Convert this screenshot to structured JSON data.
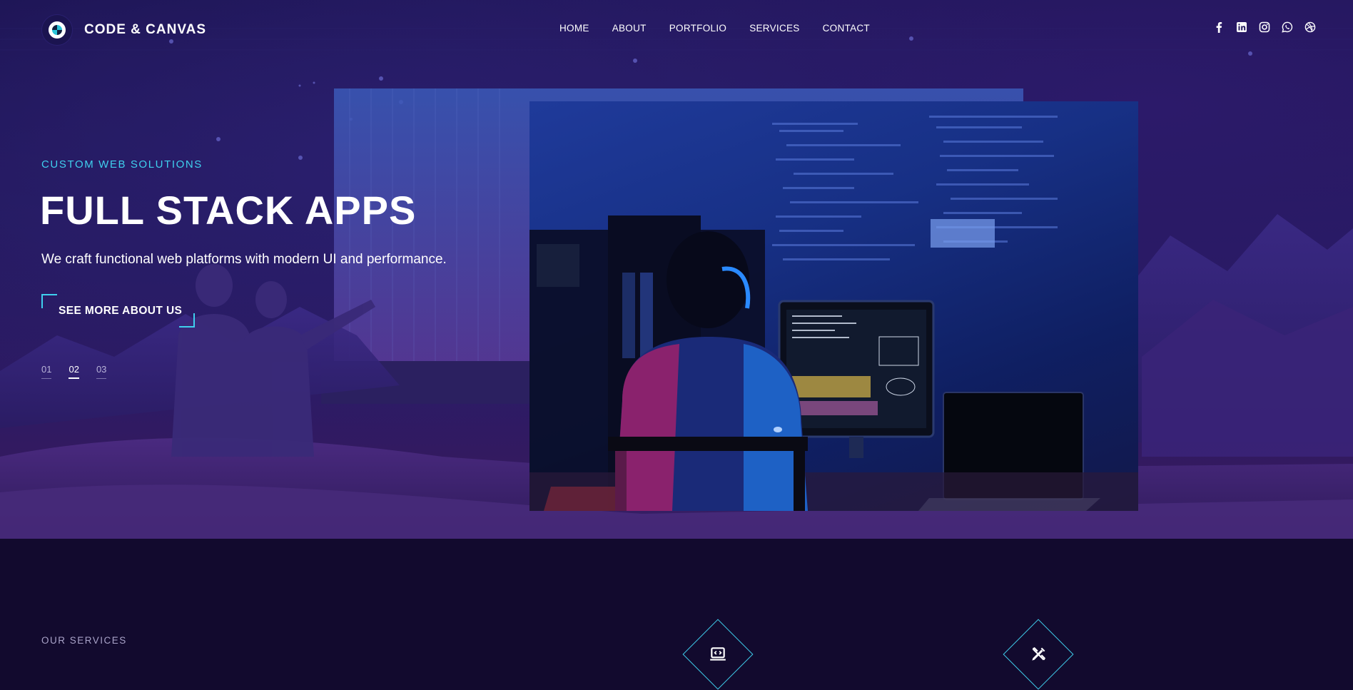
{
  "brand": {
    "name": "CODE & CANVAS"
  },
  "nav": {
    "items": [
      {
        "label": "HOME"
      },
      {
        "label": "ABOUT"
      },
      {
        "label": "PORTFOLIO"
      },
      {
        "label": "SERVICES"
      },
      {
        "label": "CONTACT"
      }
    ]
  },
  "social": [
    "facebook-icon",
    "linkedin-icon",
    "instagram-icon",
    "whatsapp-icon",
    "dribbble-icon"
  ],
  "hero": {
    "tagline": "CUSTOM WEB SOLUTIONS",
    "title": "FULL STACK APPS",
    "subtitle": "We craft functional web platforms with modern UI and performance.",
    "cta_label": "SEE MORE ABOUT US",
    "slides": [
      "01",
      "02",
      "03"
    ],
    "active_slide": "02"
  },
  "services": {
    "label": "OUR SERVICES",
    "icons": [
      "code-laptop-icon",
      "design-tools-icon"
    ]
  },
  "colors": {
    "accent": "#3fd0ee",
    "background": "#120a2e",
    "hero_top": "#1b1350"
  }
}
